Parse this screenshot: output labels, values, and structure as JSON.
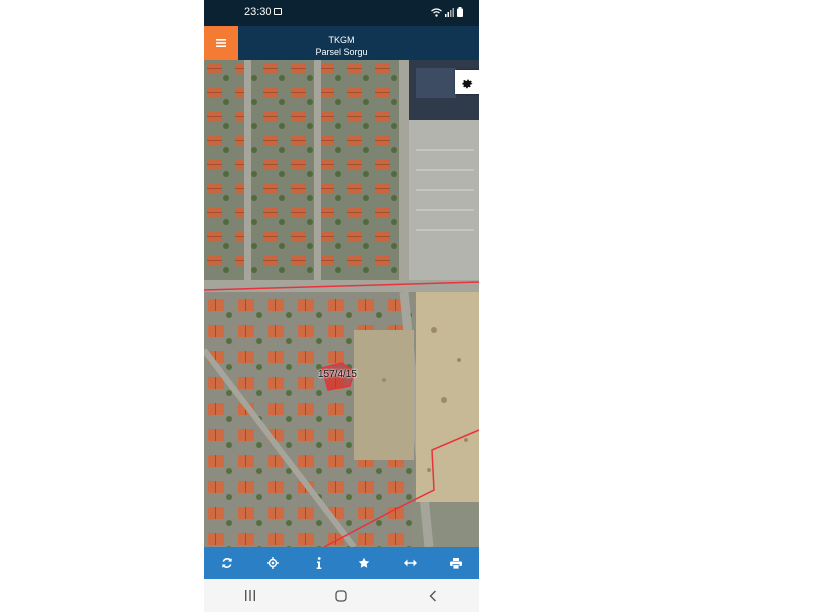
{
  "status_bar": {
    "time": "23:30"
  },
  "header": {
    "title": "TKGM",
    "subtitle": "Parsel Sorgu"
  },
  "map": {
    "parcel_label": "157/4/15"
  },
  "colors": {
    "status_bar": "#0b2233",
    "header": "#0f3552",
    "menu_button": "#f47b33",
    "toolbar": "#2b7fc4",
    "parcel_boundary": "#e8333c"
  },
  "toolbar": {
    "icons": [
      "refresh-icon",
      "locate-icon",
      "info-icon",
      "star-icon",
      "measure-icon",
      "print-icon"
    ]
  },
  "nav": {
    "icons": [
      "recent-apps-icon",
      "home-icon",
      "back-icon"
    ]
  }
}
